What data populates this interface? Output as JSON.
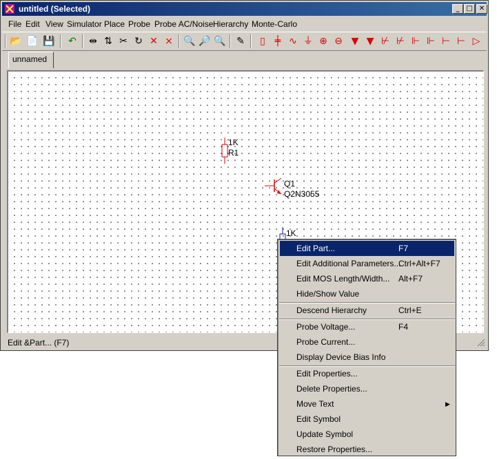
{
  "window": {
    "title": "untitled (Selected)",
    "caption_buttons": [
      "_",
      "□",
      "✕"
    ]
  },
  "menu": [
    "File",
    "Edit",
    "View",
    "Simulator",
    "Place",
    "Probe",
    "Probe AC/Noise",
    "Hierarchy",
    "Monte-Carlo"
  ],
  "tabs": [
    {
      "label": "unnamed"
    }
  ],
  "parts": {
    "r1": {
      "value": "1K",
      "ref": "R1"
    },
    "q1": {
      "ref": "Q1",
      "model": "Q2N3055"
    },
    "r2": {
      "value": "1K"
    }
  },
  "status": {
    "text": "Edit &Part... (F7)"
  },
  "context_menu": {
    "items": [
      {
        "label": "Edit Part...",
        "shortcut": "F7",
        "selected": true
      },
      {
        "label": "Edit Additional Parameters...",
        "shortcut": "Ctrl+Alt+F7"
      },
      {
        "label": "Edit MOS Length/Width...",
        "shortcut": "Alt+F7"
      },
      {
        "label": "Hide/Show Value",
        "shortcut": ""
      },
      {
        "label": "Descend Hierarchy",
        "shortcut": "Ctrl+E"
      },
      {
        "label": "Probe Voltage...",
        "shortcut": "F4"
      },
      {
        "label": "Probe Current...",
        "shortcut": ""
      },
      {
        "label": "Display Device Bias Info",
        "shortcut": ""
      },
      {
        "label": "Edit Properties...",
        "shortcut": ""
      },
      {
        "label": "Delete Properties...",
        "shortcut": ""
      },
      {
        "label": "Move Text",
        "shortcut": "",
        "submenu": true
      },
      {
        "label": "Edit Symbol",
        "shortcut": ""
      },
      {
        "label": "Update Symbol",
        "shortcut": ""
      },
      {
        "label": "Restore Properties...",
        "shortcut": ""
      }
    ]
  },
  "colors": {
    "selection": "#0a246a",
    "component": "#e00000",
    "selected_component": "#1a1aa0"
  }
}
